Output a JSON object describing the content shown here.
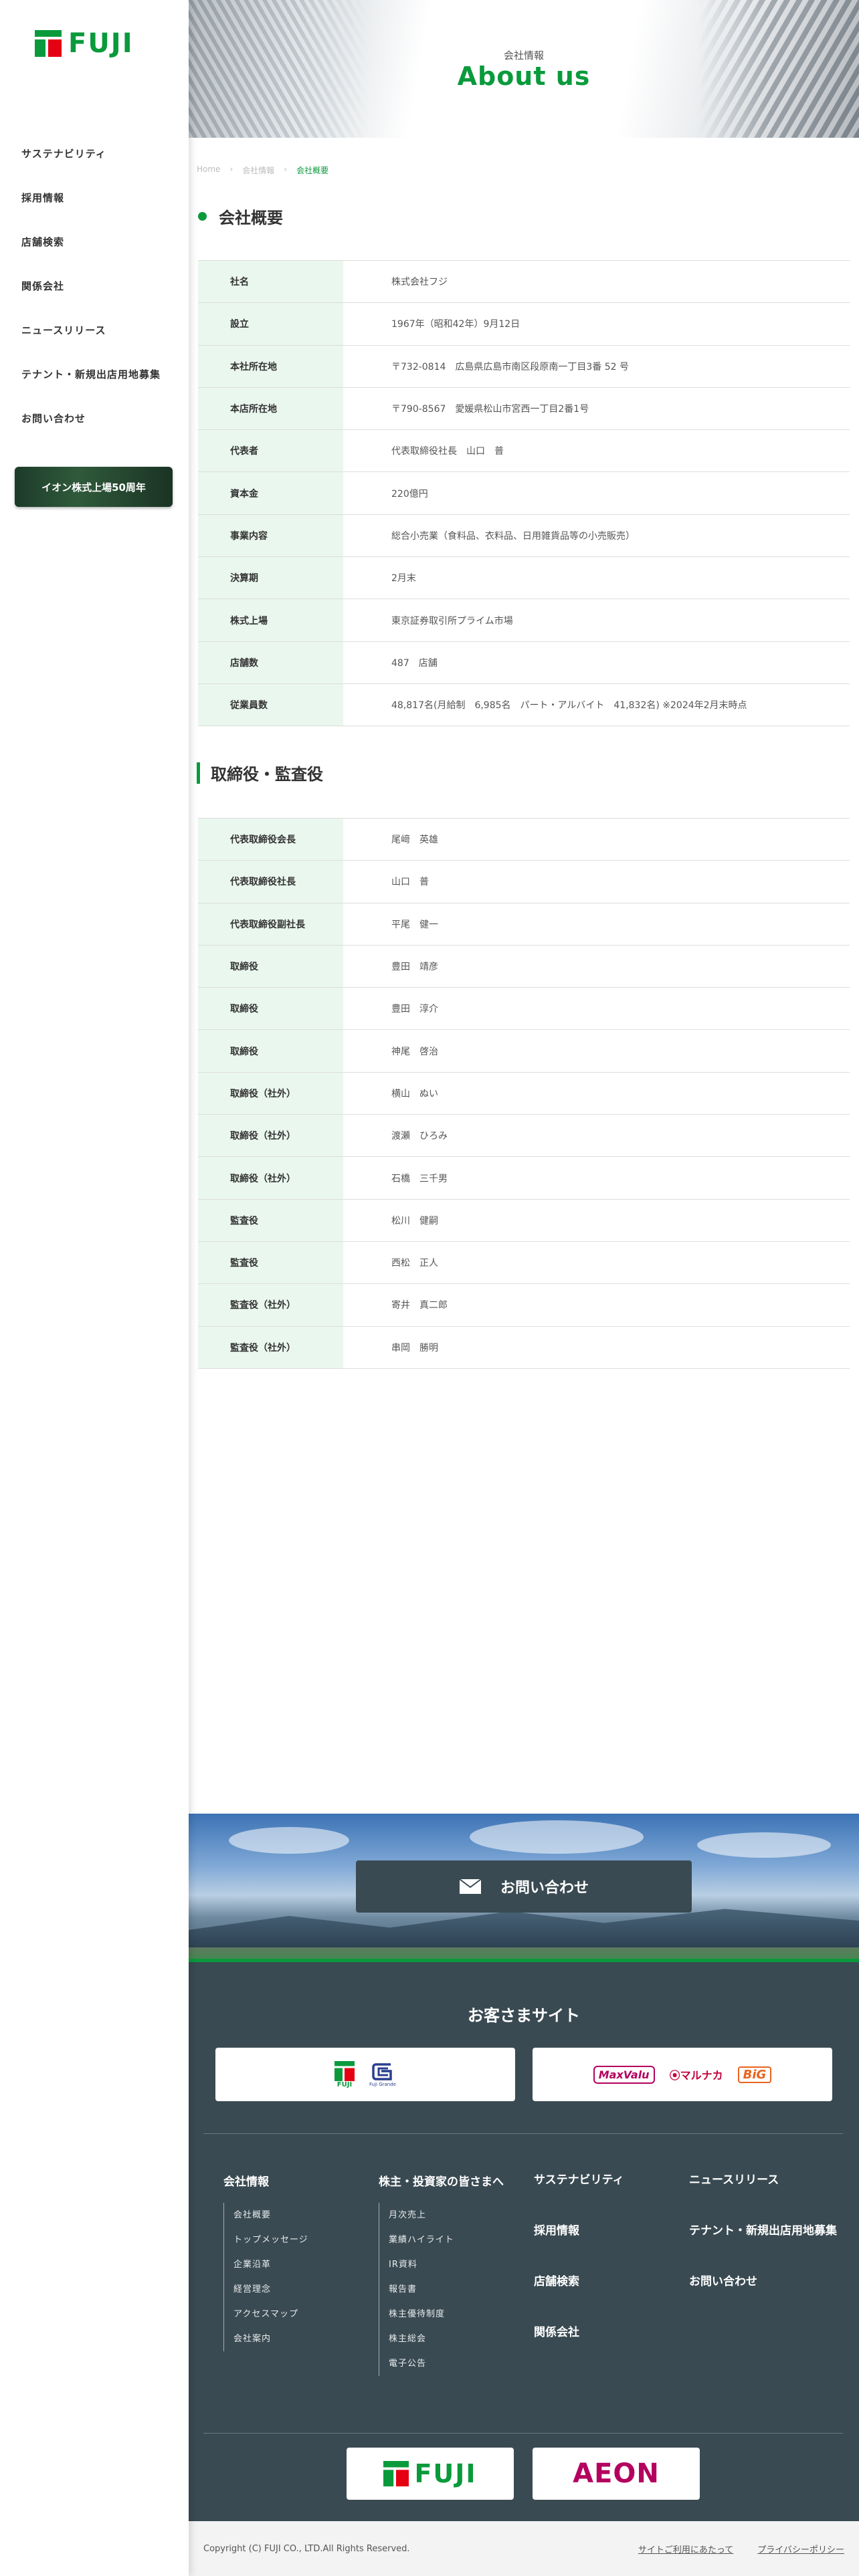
{
  "brand": {
    "name": "FUJI",
    "green": "#0a9a3c",
    "red": "#e50012"
  },
  "sidebar": {
    "items": [
      {
        "label": "サステナビリティ"
      },
      {
        "label": "採用情報"
      },
      {
        "label": "店舗検索"
      },
      {
        "label": "関係会社"
      },
      {
        "label": "ニュースリリース"
      },
      {
        "label": "テナント・新規出店用地募集"
      },
      {
        "label": "お問い合わせ"
      }
    ],
    "anniversary_banner": "イオン株式上場50周年"
  },
  "hero": {
    "subtitle": "会社情報",
    "title": "About us"
  },
  "breadcrumb": [
    "Home",
    "会社情報",
    "会社概要"
  ],
  "company": {
    "title": "会社概要",
    "rows": [
      {
        "label": "社名",
        "value": "株式会社フジ"
      },
      {
        "label": "設立",
        "value": "1967年（昭和42年）9月12日"
      },
      {
        "label": "本社所在地",
        "value": "〒732-0814　広島県広島市南区段原南一丁目3番 52 号"
      },
      {
        "label": "本店所在地",
        "value": "〒790-8567　愛媛県松山市宮西一丁目2番1号"
      },
      {
        "label": "代表者",
        "value": "代表取締役社長　山口　普"
      },
      {
        "label": "資本金",
        "value": "220億円"
      },
      {
        "label": "事業内容",
        "value": "総合小売業（食料品、衣料品、日用雑貨品等の小売販売）"
      },
      {
        "label": "決算期",
        "value": "2月末"
      },
      {
        "label": "株式上場",
        "value": "東京証券取引所プライム市場"
      },
      {
        "label": "店舗数",
        "value": "487　店舗"
      },
      {
        "label": "従業員数",
        "value": "48,817名(月給制　6,985名　パート・アルバイト　41,832名) ※2024年2月末時点"
      }
    ]
  },
  "officers": {
    "title": "取締役・監査役",
    "rows": [
      {
        "label": "代表取締役会長",
        "value": "尾﨑　英雄"
      },
      {
        "label": "代表取締役社長",
        "value": "山口　普"
      },
      {
        "label": "代表取締役副社長",
        "value": "平尾　健一"
      },
      {
        "label": "取締役",
        "value": "豊田　靖彦"
      },
      {
        "label": "取締役",
        "value": "豊田　淳介"
      },
      {
        "label": "取締役",
        "value": "神尾　啓治"
      },
      {
        "label": "取締役（社外）",
        "value": "横山　ぬい"
      },
      {
        "label": "取締役（社外）",
        "value": "渡瀬　ひろみ"
      },
      {
        "label": "取締役（社外）",
        "value": "石橋　三千男"
      },
      {
        "label": "監査役",
        "value": "松川　健嗣"
      },
      {
        "label": "監査役",
        "value": "西松　正人"
      },
      {
        "label": "監査役（社外）",
        "value": "寄井　真二郎"
      },
      {
        "label": "監査役（社外）",
        "value": "串岡　勝明"
      }
    ]
  },
  "contact": {
    "button_label": "お問い合わせ"
  },
  "footer": {
    "customer_sites_title": "お客さまサイト",
    "customer_sites": {
      "left": [
        "FUJI",
        "Fuji Grande"
      ],
      "right": [
        "MaxValu",
        "マルナカ",
        "BiG"
      ]
    },
    "col1": {
      "title": "会社情報",
      "items": [
        "会社概要",
        "トップメッセージ",
        "企業沿革",
        "経営理念",
        "アクセスマップ",
        "会社案内"
      ]
    },
    "col2": {
      "title": "株主・投資家の皆さまへ",
      "items": [
        "月次売上",
        "業績ハイライト",
        "IR資料",
        "報告書",
        "株主優待制度",
        "株主総会",
        "電子公告"
      ]
    },
    "col3": {
      "items": [
        "サステナビリティ",
        "採用情報",
        "店舗検索",
        "関係会社"
      ]
    },
    "col4": {
      "items": [
        "ニュースリリース",
        "テナント・新規出店用地募集",
        "お問い合わせ"
      ]
    },
    "logos": [
      "FUJI",
      "AEON"
    ],
    "copyright": "Copyright (C) FUJI CO., LTD.All Rights Reserved.",
    "links": [
      "サイトご利用にあたって",
      "プライバシーポリシー"
    ]
  }
}
